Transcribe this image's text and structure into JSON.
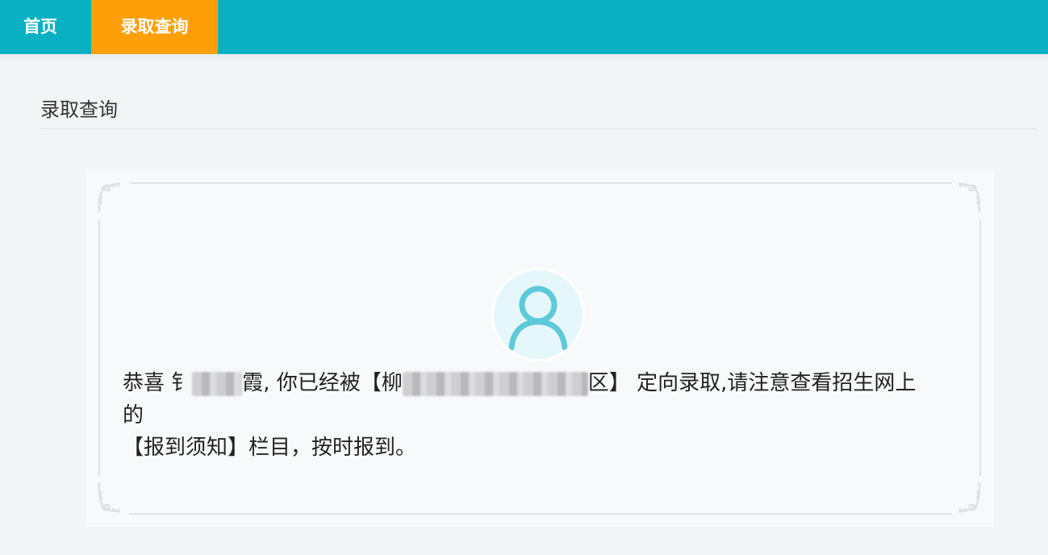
{
  "nav": {
    "items": [
      {
        "label": "首页"
      },
      {
        "label": "录取查询",
        "active": true
      }
    ],
    "bar_color": "#07b1c2",
    "active_color": "#fd9f07"
  },
  "page": {
    "section_title": "录取查询"
  },
  "result": {
    "avatar_icon": "user-icon",
    "msg_prefix": "恭喜 ",
    "name_visible_start": "钅",
    "name_visible_end": "霞",
    "msg_mid": ", 你已经被【",
    "org_visible_start": "柳",
    "org_visible_end": "区】 定向录取,请注意查看招生网上的",
    "msg_line2": "【报到须知】栏目，按时报到。"
  }
}
